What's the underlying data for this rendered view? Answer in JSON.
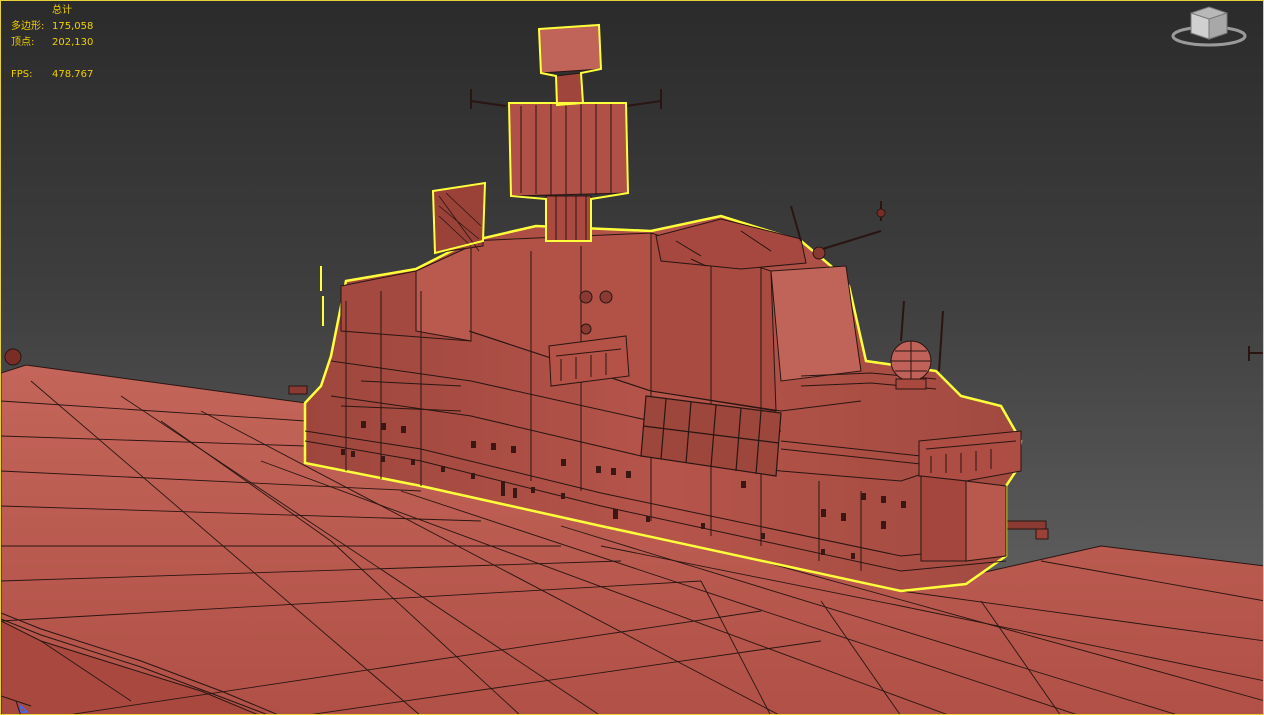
{
  "viewport": {
    "stats_header": "总计",
    "polygons_label": "多边形:",
    "polygons_value": "175,058",
    "vertices_label": "顶点:",
    "vertices_value": "202,130",
    "fps_label": "FPS:",
    "fps_value": "478.767"
  },
  "colors": {
    "model_fill": "#b9564c",
    "wire": "#2a1512",
    "selection": "#ffff3c",
    "stats_text": "#f0d000"
  },
  "icons": [
    "viewcube-icon",
    "axis-tripod-icon"
  ]
}
